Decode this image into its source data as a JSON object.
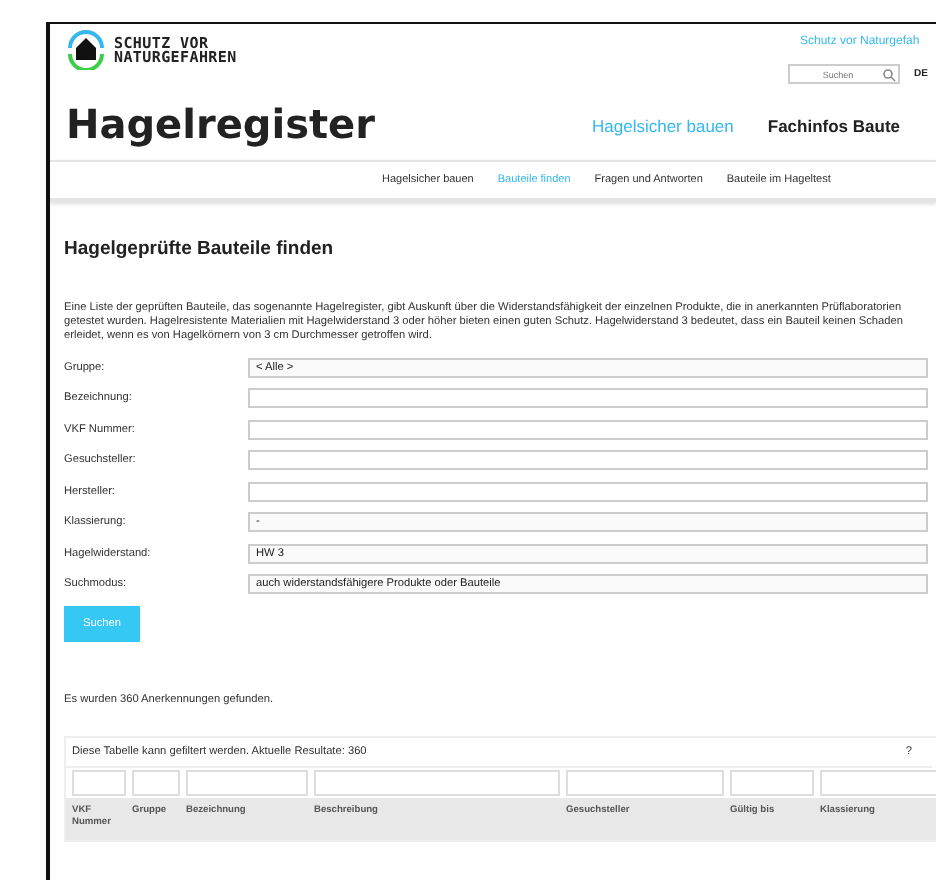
{
  "header": {
    "logo_lines": [
      "SCHUTZ VOR",
      "NATURGEFAHREN"
    ],
    "top_link": "Schutz vor Naturgefah",
    "search": {
      "placeholder": "Suchen"
    },
    "languages": [
      {
        "label": "DE",
        "selected": true
      }
    ],
    "site_title": "Hagelregister",
    "main_nav": [
      {
        "label": "Hagelsicher bauen",
        "selected": true
      },
      {
        "label": "Fachinfos Baute",
        "selected": false
      }
    ]
  },
  "sub_nav": [
    {
      "label": "Hagelsicher bauen",
      "selected": false
    },
    {
      "label": "Bauteile finden",
      "selected": true
    },
    {
      "label": "Fragen und Antworten",
      "selected": false
    },
    {
      "label": "Bauteile im Hageltest",
      "selected": false
    }
  ],
  "heading": "Hagelgeprüfte Bauteile finden",
  "intro": "Eine Liste der geprüften Bauteile, das sogenannte Hagelregister, gibt Auskunft über die Widerstandsfähigkeit der einzelnen Produkte, die in anerkannten Prüflaboratorien getestet wurden. Hagelresistente Materialien mit Hagelwiderstand 3 oder höher bieten einen guten Schutz. Hagelwiderstand 3 bedeutet, dass ein Bauteil keinen Schaden erleidet, wenn es von Hagelkörnern von 3 cm Durchmesser getroffen wird.",
  "form": {
    "fields": [
      {
        "label": "Gruppe:",
        "kind": "select",
        "value": "< Alle >"
      },
      {
        "label": "Bezeichnung:",
        "kind": "text"
      },
      {
        "label": "VKF Nummer:",
        "kind": "text"
      },
      {
        "label": "Gesuchsteller:",
        "kind": "text"
      },
      {
        "label": "Hersteller:",
        "kind": "text"
      },
      {
        "label": "Klassierung:",
        "kind": "select",
        "value": "-"
      },
      {
        "label": "Hagelwiderstand:",
        "kind": "select",
        "value": "HW 3"
      },
      {
        "label": "Suchmodus:",
        "kind": "select",
        "value": "auch widerstandsfähigere Produkte oder Bauteile"
      }
    ],
    "submit": "Suchen"
  },
  "result_text": "Es wurden 360 Anerkennungen gefunden.",
  "table": {
    "filter_note": "Diese Tabelle kann gefiltert werden. Aktuelle Resultate: 360",
    "help": "?",
    "columns": [
      "VKF Nummer",
      "Gruppe",
      "Bezeichnung",
      "Beschreibung",
      "Gesuchsteller",
      "Gültig bis",
      "Klassierung"
    ]
  }
}
